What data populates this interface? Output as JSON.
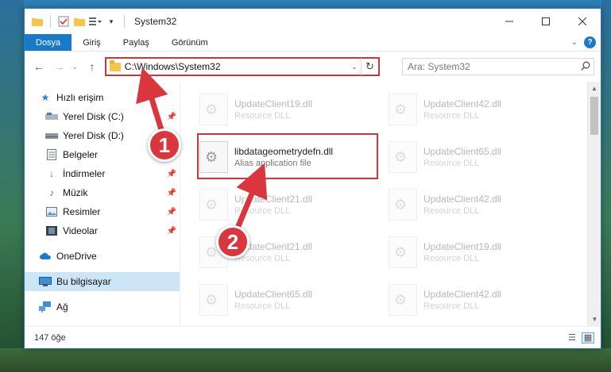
{
  "window": {
    "title": "System32"
  },
  "ribbon": {
    "tabs": [
      "Dosya",
      "Giriş",
      "Paylaş",
      "Görünüm"
    ],
    "file_tab_color": "#1979ca"
  },
  "address": {
    "path": "C:\\Windows\\System32",
    "highlight_color": "#d0343b"
  },
  "search": {
    "placeholder": "Ara: System32"
  },
  "sidebar": {
    "items": [
      {
        "label": "Hızlı erişim",
        "icon": "star-icon"
      },
      {
        "label": "Yerel Disk (C:)",
        "icon": "drive-icon",
        "pinned": true
      },
      {
        "label": "Yerel Disk (D:)",
        "icon": "drive-icon"
      },
      {
        "label": "Belgeler",
        "icon": "documents-icon",
        "pinned": true
      },
      {
        "label": "İndirmeler",
        "icon": "download-icon",
        "pinned": true
      },
      {
        "label": "Müzik",
        "icon": "music-icon",
        "pinned": true
      },
      {
        "label": "Resimler",
        "icon": "pictures-icon",
        "pinned": true
      },
      {
        "label": "Videolar",
        "icon": "video-icon",
        "pinned": true
      },
      {
        "label": "OneDrive",
        "icon": "cloud-icon"
      },
      {
        "label": "Bu bilgisayar",
        "icon": "computer-icon",
        "selected": true
      },
      {
        "label": "Ağ",
        "icon": "network-icon"
      }
    ]
  },
  "files": {
    "items": [
      {
        "name": "UpdateClient19.dll",
        "desc": "Resource DLL",
        "faded": true
      },
      {
        "name": "UpdateClient42.dll",
        "desc": "Resource DLL",
        "faded": true
      },
      {
        "name": "libdatageometrydefn.dll",
        "desc": "Alias application file",
        "faded": false
      },
      {
        "name": "UpdateClient65.dll",
        "desc": "Resource DLL",
        "faded": true
      },
      {
        "name": "UpdateClient21.dll",
        "desc": "Resource DLL",
        "faded": true
      },
      {
        "name": "UpdateClient42.dll",
        "desc": "Resource DLL",
        "faded": true
      },
      {
        "name": "UpdateClient21.dll",
        "desc": "Resource DLL",
        "faded": true
      },
      {
        "name": "UpdateClient19.dll",
        "desc": "Resource DLL",
        "faded": true
      },
      {
        "name": "UpdateClient65.dll",
        "desc": "Resource DLL",
        "faded": true
      },
      {
        "name": "UpdateClient42.dll",
        "desc": "Resource DLL",
        "faded": true
      }
    ]
  },
  "status": {
    "count": "147 öğe"
  },
  "annotations": {
    "step1": "1",
    "step2": "2",
    "color": "#d9363e"
  }
}
